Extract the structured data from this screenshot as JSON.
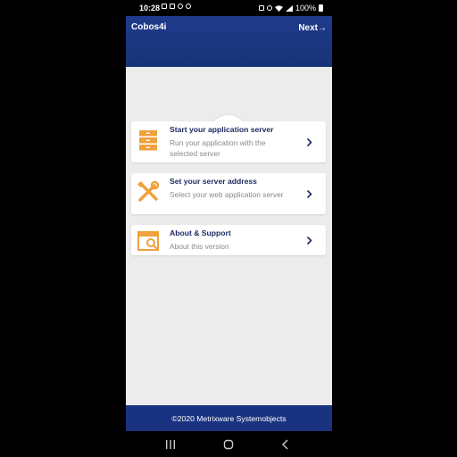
{
  "status_bar": {
    "time": "10:28",
    "battery": "100%"
  },
  "header": {
    "title": "Cobos4i",
    "next_label": "Next→"
  },
  "cards": [
    {
      "title": "Start your application server",
      "description": "Run your application with the selected server",
      "icon": "server-icon"
    },
    {
      "title": "Set your server address",
      "description": "Select your web application server",
      "icon": "tools-icon"
    },
    {
      "title": "About & Support",
      "description": "About this version",
      "icon": "about-support-icon"
    }
  ],
  "footer": {
    "text": "©2020 Metrixware Systemobjects"
  },
  "colors": {
    "brand_blue": "#1a3381",
    "accent_orange": "#f0a13d",
    "card_title": "#1c2b63"
  }
}
